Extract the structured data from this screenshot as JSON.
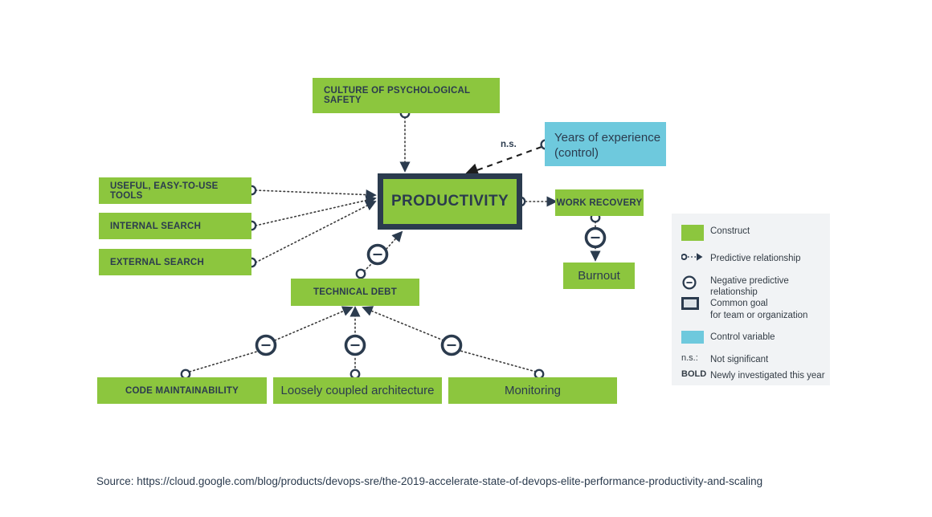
{
  "diagram": {
    "title": "DevOps productivity research model",
    "colors": {
      "construct": "#8cc63e",
      "control": "#6ec9dd",
      "ink": "#2b3b4e",
      "legend_bg": "#f1f3f5",
      "edge": "#3a3a3a"
    },
    "nodes": [
      {
        "id": "culture",
        "label": "CULTURE OF PSYCHOLOGICAL SAFETY",
        "style": "bold",
        "type": "construct"
      },
      {
        "id": "tools",
        "label": "USEFUL, EASY-TO-USE TOOLS",
        "style": "bold",
        "type": "construct"
      },
      {
        "id": "internal",
        "label": "INTERNAL SEARCH",
        "style": "bold",
        "type": "construct"
      },
      {
        "id": "external",
        "label": "EXTERNAL SEARCH",
        "style": "bold",
        "type": "construct"
      },
      {
        "id": "techdebt",
        "label": "TECHNICAL DEBT",
        "style": "bold",
        "type": "construct"
      },
      {
        "id": "codemaint",
        "label": "CODE MAINTAINABILITY",
        "style": "bold",
        "type": "construct"
      },
      {
        "id": "loosely",
        "label": "Loosely coupled architecture",
        "style": "reg",
        "type": "construct"
      },
      {
        "id": "monitoring",
        "label": "Monitoring",
        "style": "reg",
        "type": "construct"
      },
      {
        "id": "workrec",
        "label": "WORK RECOVERY",
        "style": "bold",
        "type": "construct"
      },
      {
        "id": "burnout",
        "label": "Burnout",
        "style": "reg",
        "type": "construct"
      },
      {
        "id": "productivity",
        "label": "PRODUCTIVITY",
        "style": "goal",
        "type": "common-goal"
      },
      {
        "id": "years",
        "label": "Years of experience\n(control)",
        "line1": "Years of experience",
        "line2": "(control)",
        "style": "reg",
        "type": "control"
      }
    ],
    "edges": [
      {
        "from": "culture",
        "to": "productivity",
        "kind": "predictive"
      },
      {
        "from": "tools",
        "to": "productivity",
        "kind": "predictive"
      },
      {
        "from": "internal",
        "to": "productivity",
        "kind": "predictive"
      },
      {
        "from": "external",
        "to": "productivity",
        "kind": "predictive"
      },
      {
        "from": "techdebt",
        "to": "productivity",
        "kind": "negative-predictive"
      },
      {
        "from": "codemaint",
        "to": "techdebt",
        "kind": "negative-predictive"
      },
      {
        "from": "loosely",
        "to": "techdebt",
        "kind": "negative-predictive"
      },
      {
        "from": "monitoring",
        "to": "techdebt",
        "kind": "negative-predictive"
      },
      {
        "from": "productivity",
        "to": "workrec",
        "kind": "predictive"
      },
      {
        "from": "workrec",
        "to": "burnout",
        "kind": "negative-predictive"
      },
      {
        "from": "years",
        "to": "productivity",
        "kind": "not-significant",
        "label": "n.s."
      }
    ],
    "ns_label": "n.s."
  },
  "legend": {
    "rows": [
      {
        "icon": "green-swatch",
        "text": "Construct"
      },
      {
        "icon": "predictive-arrow",
        "text": "Predictive relationship"
      },
      {
        "icon": "negative-circle",
        "text": "Negative predictive relationship"
      },
      {
        "icon": "goal-box",
        "text": "Common goal",
        "text2": "for team or organization"
      },
      {
        "icon": "blue-swatch",
        "text": "Control variable"
      },
      {
        "abbr": "n.s.:",
        "text": "Not significant"
      },
      {
        "abbr": "BOLD",
        "abbr_bold": true,
        "text": "Newly investigated this year"
      }
    ]
  },
  "source": {
    "text": "Source: https://cloud.google.com/blog/products/devops-sre/the-2019-accelerate-state-of-devops-elite-performance-productivity-and-scaling"
  }
}
